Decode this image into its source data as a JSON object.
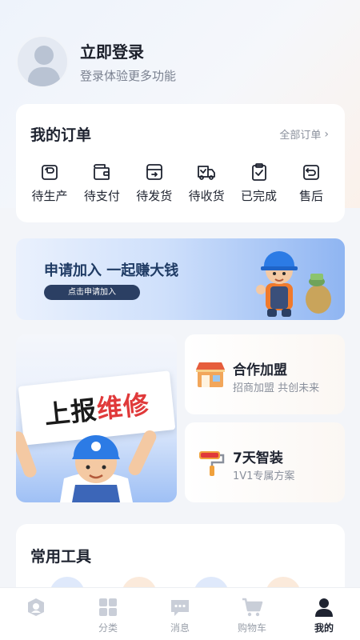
{
  "profile": {
    "title": "立即登录",
    "subtitle": "登录体验更多功能"
  },
  "orders": {
    "title": "我的订单",
    "all_label": "全部订单",
    "items": [
      {
        "label": "待生产",
        "icon": "production-icon"
      },
      {
        "label": "待支付",
        "icon": "wallet-icon"
      },
      {
        "label": "待发货",
        "icon": "shipping-box-icon"
      },
      {
        "label": "待收货",
        "icon": "delivery-truck-icon"
      },
      {
        "label": "已完成",
        "icon": "clipboard-check-icon"
      },
      {
        "label": "售后",
        "icon": "return-icon"
      }
    ]
  },
  "banner": {
    "title": "申请加入 一起赚大钱",
    "button": "点击申请加入"
  },
  "repair": {
    "sign_part1": "上报",
    "sign_part2": "维修"
  },
  "franchise": {
    "title": "合作加盟",
    "subtitle": "招商加盟  共创未来"
  },
  "decor": {
    "title": "7天智装",
    "subtitle": "1V1专属方案"
  },
  "tools": {
    "title": "常用工具"
  },
  "tabbar": {
    "items": [
      {
        "label": "",
        "icon": "home-badge-icon"
      },
      {
        "label": "分类",
        "icon": "grid-icon"
      },
      {
        "label": "消息",
        "icon": "message-icon"
      },
      {
        "label": "购物车",
        "icon": "cart-icon"
      },
      {
        "label": "我的",
        "icon": "person-icon",
        "active": true
      }
    ]
  },
  "colors": {
    "accent_dark": "#2b3f63",
    "repair_red": "#e0393a",
    "icon_gray": "#c9ced8"
  }
}
